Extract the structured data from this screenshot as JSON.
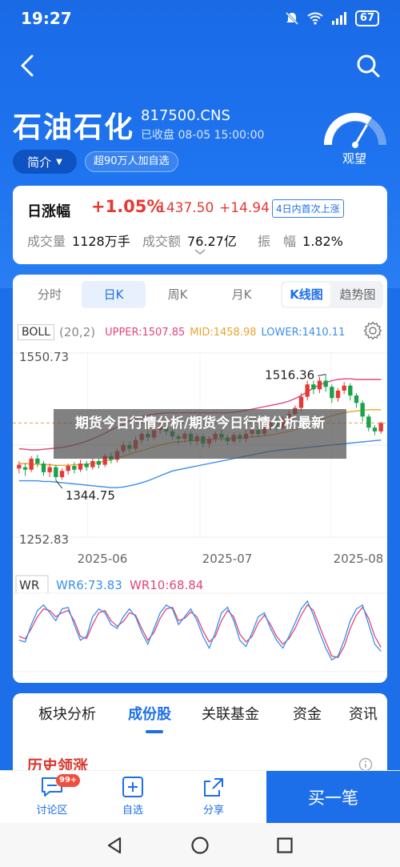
{
  "status": {
    "time": "19:27",
    "battery": "67"
  },
  "stock": {
    "name": "石油石化",
    "code": "817500.CNS",
    "close_time": "已收盘  08-05 15:00:00",
    "intro_label": "简介",
    "watchers": "超90万人加自选",
    "sentiment": "观望"
  },
  "quote": {
    "label": "日涨幅",
    "change_pct": "+1.05%",
    "price": "1437.50",
    "change": "+14.94",
    "tag": "4日内首次上涨",
    "volume_label": "成交量",
    "volume": "1128万手",
    "turnover_label": "成交额",
    "turnover": "76.27亿",
    "amplitude_label": "振　幅",
    "amplitude": "1.82%"
  },
  "chart_tabs": {
    "t1": "分时",
    "t2": "日K",
    "t3": "周K",
    "t4": "月K",
    "kline": "K线图",
    "trend": "趋势图"
  },
  "boll": {
    "name": "BOLL",
    "params": "(20,2)",
    "upper": "UPPER:1507.85",
    "mid": "MID:1458.98",
    "lower": "LOWER:1410.11"
  },
  "wr": {
    "name": "WR",
    "wr6": "WR6:73.83",
    "wr10": "WR10:68.84"
  },
  "banner": "期货今日行情分析/期货今日行情分析最新",
  "bottom_tabs": {
    "b1": "板块分析",
    "b2": "成份股",
    "b3": "关联基金",
    "b4": "资金",
    "b5": "资讯"
  },
  "history_title": "历史领涨",
  "footer": {
    "discuss": "讨论区",
    "badge": "99+",
    "watchlist": "自选",
    "share": "分享",
    "buy": "买一笔"
  },
  "colors": {
    "up": "#e53935",
    "down": "#16a34a",
    "brand": "#1c6fe8",
    "upper": "#e0457b",
    "mid": "#e6a52e",
    "lower": "#3b8fe8"
  },
  "chart_data": {
    "type": "candlestick",
    "y_ticks": [
      "1550.73",
      "1252.83"
    ],
    "ylim": [
      1252.83,
      1550.73
    ],
    "x_ticks": [
      "2025-06",
      "2025-07",
      "2025-08"
    ],
    "annotations": {
      "high": "1516.36",
      "low": "1344.75"
    },
    "candles": [
      [
        1364,
        1370,
        1356,
        1376
      ],
      [
        1366,
        1362,
        1352,
        1372
      ],
      [
        1362,
        1380,
        1358,
        1384
      ],
      [
        1380,
        1372,
        1366,
        1386
      ],
      [
        1372,
        1358,
        1352,
        1376
      ],
      [
        1358,
        1366,
        1350,
        1372
      ],
      [
        1366,
        1350,
        1344.75,
        1370
      ],
      [
        1350,
        1360,
        1346,
        1364
      ],
      [
        1360,
        1368,
        1354,
        1372
      ],
      [
        1368,
        1362,
        1356,
        1374
      ],
      [
        1362,
        1372,
        1358,
        1378
      ],
      [
        1372,
        1366,
        1360,
        1376
      ],
      [
        1366,
        1376,
        1362,
        1380
      ],
      [
        1376,
        1370,
        1364,
        1380
      ],
      [
        1370,
        1384,
        1366,
        1388
      ],
      [
        1384,
        1378,
        1372,
        1390
      ],
      [
        1378,
        1392,
        1374,
        1396
      ],
      [
        1392,
        1402,
        1388,
        1408
      ],
      [
        1402,
        1396,
        1390,
        1408
      ],
      [
        1396,
        1410,
        1392,
        1416
      ],
      [
        1410,
        1420,
        1404,
        1424
      ],
      [
        1420,
        1414,
        1408,
        1426
      ],
      [
        1414,
        1426,
        1410,
        1432
      ],
      [
        1426,
        1432,
        1420,
        1438
      ],
      [
        1432,
        1424,
        1418,
        1436
      ],
      [
        1424,
        1416,
        1410,
        1430
      ],
      [
        1416,
        1412,
        1404,
        1420
      ],
      [
        1412,
        1420,
        1406,
        1424
      ],
      [
        1420,
        1408,
        1402,
        1424
      ],
      [
        1408,
        1416,
        1402,
        1420
      ],
      [
        1416,
        1404,
        1398,
        1420
      ],
      [
        1404,
        1412,
        1398,
        1416
      ],
      [
        1412,
        1420,
        1406,
        1424
      ],
      [
        1420,
        1414,
        1408,
        1426
      ],
      [
        1414,
        1408,
        1402,
        1418
      ],
      [
        1408,
        1418,
        1404,
        1422
      ],
      [
        1418,
        1412,
        1406,
        1422
      ],
      [
        1412,
        1420,
        1406,
        1426
      ],
      [
        1420,
        1426,
        1414,
        1430
      ],
      [
        1426,
        1420,
        1414,
        1432
      ],
      [
        1420,
        1432,
        1416,
        1436
      ],
      [
        1432,
        1438,
        1426,
        1442
      ],
      [
        1438,
        1430,
        1424,
        1444
      ],
      [
        1430,
        1444,
        1426,
        1448
      ],
      [
        1444,
        1452,
        1438,
        1458
      ],
      [
        1452,
        1462,
        1446,
        1466
      ],
      [
        1462,
        1480,
        1456,
        1486
      ],
      [
        1480,
        1500,
        1474,
        1506
      ],
      [
        1500,
        1492,
        1484,
        1506
      ],
      [
        1492,
        1506,
        1486,
        1512
      ],
      [
        1506,
        1496,
        1488,
        1516.36
      ],
      [
        1496,
        1478,
        1470,
        1500
      ],
      [
        1478,
        1490,
        1472,
        1494
      ],
      [
        1490,
        1498,
        1484,
        1504
      ],
      [
        1498,
        1482,
        1474,
        1502
      ],
      [
        1482,
        1470,
        1462,
        1486
      ],
      [
        1470,
        1448,
        1440,
        1474
      ],
      [
        1448,
        1430,
        1424,
        1452
      ],
      [
        1430,
        1424,
        1418,
        1434
      ],
      [
        1424,
        1437.5,
        1420,
        1440
      ]
    ],
    "boll_upper": [
      1396,
      1395,
      1394,
      1394,
      1395,
      1396,
      1397,
      1398,
      1400,
      1402,
      1405,
      1408,
      1412,
      1416,
      1421,
      1426,
      1431,
      1436,
      1441,
      1445,
      1448,
      1450,
      1452,
      1453,
      1454,
      1454,
      1454,
      1454,
      1454,
      1454,
      1454,
      1454,
      1454,
      1454,
      1454,
      1455,
      1456,
      1458,
      1460,
      1462,
      1464,
      1466,
      1468,
      1470,
      1473,
      1477,
      1482,
      1488,
      1494,
      1499,
      1503,
      1506,
      1508,
      1509,
      1509,
      1508,
      1508,
      1508,
      1508,
      1508
    ],
    "boll_mid": [
      1372,
      1372,
      1371,
      1371,
      1370,
      1370,
      1369,
      1369,
      1369,
      1370,
      1370,
      1371,
      1372,
      1374,
      1376,
      1378,
      1381,
      1384,
      1387,
      1390,
      1393,
      1396,
      1399,
      1402,
      1404,
      1406,
      1407,
      1408,
      1409,
      1410,
      1410,
      1411,
      1411,
      1412,
      1412,
      1413,
      1413,
      1414,
      1415,
      1416,
      1417,
      1418,
      1420,
      1422,
      1424,
      1427,
      1430,
      1434,
      1438,
      1442,
      1446,
      1449,
      1452,
      1454,
      1456,
      1457,
      1458,
      1459,
      1459,
      1459
    ],
    "boll_lower": [
      1344,
      1344,
      1344,
      1344,
      1343,
      1343,
      1342,
      1341,
      1340,
      1339,
      1338,
      1337,
      1336,
      1335,
      1334,
      1333,
      1333,
      1334,
      1336,
      1338,
      1341,
      1344,
      1348,
      1352,
      1356,
      1360,
      1362,
      1364,
      1366,
      1368,
      1370,
      1372,
      1374,
      1376,
      1378,
      1380,
      1382,
      1384,
      1386,
      1388,
      1390,
      1392,
      1393,
      1394,
      1395,
      1396,
      1397,
      1398,
      1399,
      1400,
      1401,
      1402,
      1403,
      1404,
      1405,
      1406,
      1407,
      1408,
      1409,
      1410
    ],
    "wr_ticks": [
      "WR6:73.83",
      "WR10:68.84"
    ],
    "wr6": [
      60,
      62,
      40,
      22,
      15,
      25,
      35,
      20,
      18,
      40,
      60,
      55,
      30,
      20,
      25,
      40,
      45,
      30,
      20,
      30,
      50,
      65,
      45,
      25,
      15,
      20,
      40,
      30,
      20,
      35,
      55,
      70,
      50,
      25,
      18,
      35,
      60,
      68,
      50,
      30,
      25,
      45,
      60,
      70,
      55,
      38,
      20,
      10,
      28,
      50,
      70,
      85,
      80,
      60,
      35,
      20,
      15,
      40,
      65,
      73.83
    ],
    "wr10": [
      55,
      58,
      45,
      30,
      20,
      22,
      30,
      25,
      22,
      35,
      55,
      58,
      40,
      25,
      22,
      35,
      42,
      36,
      25,
      28,
      45,
      60,
      50,
      32,
      20,
      18,
      35,
      32,
      24,
      30,
      48,
      62,
      55,
      35,
      22,
      30,
      52,
      62,
      55,
      38,
      28,
      40,
      55,
      65,
      58,
      45,
      28,
      15,
      22,
      42,
      62,
      80,
      82,
      68,
      45,
      28,
      18,
      32,
      55,
      68.84
    ]
  }
}
